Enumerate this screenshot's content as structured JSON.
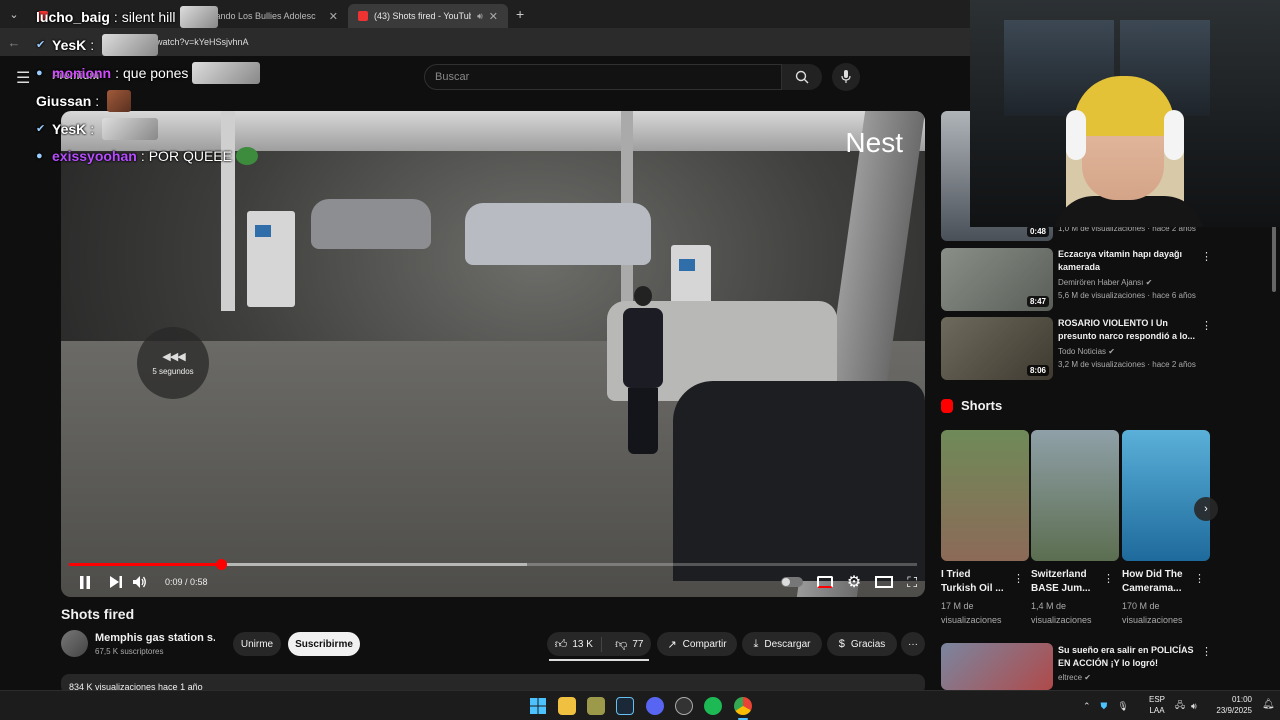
{
  "browser": {
    "tabs": [
      {
        "title": "",
        "active": false
      },
      {
        "title": "Cuando Los Bullies Adolesc",
        "active": false
      },
      {
        "title": "(43) Shots fired - YouTube",
        "active": true
      }
    ],
    "url": "m/watch?v=kYeHSsjvhnA"
  },
  "youtube": {
    "logo_text": "Premium",
    "search_placeholder": "Buscar"
  },
  "chat": [
    {
      "user": "lucho_baig",
      "sep": ":",
      "message": "silent hill",
      "user_color": "#ffffff"
    },
    {
      "user": "YesK",
      "sep": ":",
      "message": "",
      "user_color": "#ffffff"
    },
    {
      "user": "monionn",
      "sep": ":",
      "message": "que pones",
      "user_color": "#d14cff"
    },
    {
      "user": "Giussan",
      "sep": ":",
      "message": "",
      "user_color": "#ffffff"
    },
    {
      "user": "YesK",
      "sep": ":",
      "message": "",
      "user_color": "#ffffff"
    },
    {
      "user": "exissyoohan",
      "sep": ":",
      "message": "POR QUEEE",
      "user_color": "#b64cff"
    }
  ],
  "player": {
    "watermark": "Nest",
    "skip_label": "5 segundos",
    "current_time": "0:09",
    "duration": "0:58",
    "time_sep": " / ",
    "progress_fraction": 0.179,
    "buffered_fraction": 0.54
  },
  "video": {
    "title": "Shots fired",
    "channel_name": "Memphis gas station s...",
    "channel_subs": "67,5 K suscriptores",
    "join_label": "Unirme",
    "subscribe_label": "Suscribirme",
    "likes": "13 K",
    "dislikes": "77",
    "share_label": "Compartir",
    "download_label": "Descargar",
    "thanks_label": "Gracias",
    "description_meta": "834 K visualizaciones  hace 1 año"
  },
  "sidebar": {
    "partial_top": {
      "duration": "0:48",
      "meta": "1,0 M de visualizaciones · hace 2 años"
    },
    "videos": [
      {
        "title_l1": "Eczacıya vitamin hapı dayağı",
        "title_l2": "kamerada",
        "channel": "Demirören Haber Ajansı",
        "meta": "5,6 M de visualizaciones · hace 6 años",
        "duration": "8:47"
      },
      {
        "title_l1": "ROSARIO VIOLENTO I Un",
        "title_l2": "presunto narco respondió a lo...",
        "channel": "Todo Noticias",
        "meta": "3,2 M de visualizaciones · hace 2 años",
        "duration": "8:06"
      }
    ],
    "shorts_heading": "Shorts",
    "shorts": [
      {
        "title_l1": "I Tried",
        "title_l2": "Turkish Oil ...",
        "views_l1": "17 M de",
        "views_l2": "visualizaciones"
      },
      {
        "title_l1": "Switzerland",
        "title_l2": "BASE Jum...",
        "views_l1": "1,4 M de",
        "views_l2": "visualizaciones"
      },
      {
        "title_l1": "How Did The",
        "title_l2": "Camerama...",
        "views_l1": "170 M de",
        "views_l2": "visualizaciones"
      }
    ],
    "bottom_video": {
      "title_l1": "Su sueño era salir en POLICÍAS",
      "title_l2": "EN ACCIÓN ¡Y lo logró!",
      "channel": "eltrece"
    }
  },
  "taskbar": {
    "lang_l1": "ESP",
    "lang_l2": "LAA",
    "time": "01:00",
    "date": "23/9/2025"
  },
  "colors": {
    "accent": "#ff0000",
    "bg": "#0f0f0f",
    "pill": "#272727"
  }
}
